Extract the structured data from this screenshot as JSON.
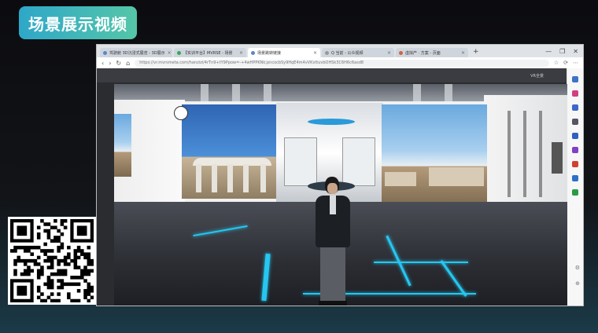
{
  "overlay": {
    "title": "场景展示视频"
  },
  "browser": {
    "tabs": [
      {
        "label": "驾驶舱 3D沉浸式展览 - 3D展示",
        "active": false
      },
      {
        "label": "【实训平台】MVRSE - 场景",
        "active": false
      },
      {
        "label": "场景跳转链接",
        "active": true
      },
      {
        "label": "Q 当前 - 公众视频",
        "active": false
      },
      {
        "label": "虚拟产 · 方案 - 页面",
        "active": false
      }
    ],
    "tab_close": "×",
    "new_tab": "+",
    "window_controls": [
      "—",
      "❐",
      "✕"
    ],
    "nav": {
      "back": "‹",
      "forward": "›",
      "reload": "↻",
      "home": "⌂"
    },
    "url": "https://vr.mvrsmeta.com/hanzizi/4rTn9+tY9Ppow=-+4wHPPKNk;pncocbSy9HqE4m4vVKvttuvbOHSk3C6H6c6asd8",
    "toolbar_icons": [
      "☆",
      "⟳",
      "⋯"
    ],
    "top_label": "VR全景",
    "side_icons": [
      {
        "name": "search",
        "color": "#3b73c8"
      },
      {
        "name": "star",
        "color": "#d04080"
      },
      {
        "name": "tag",
        "color": "#3c68c8"
      },
      {
        "name": "bag",
        "color": "#556"
      },
      {
        "name": "person",
        "color": "#3060c0"
      },
      {
        "name": "game",
        "color": "#8040c0"
      },
      {
        "name": "office",
        "color": "#d04030"
      },
      {
        "name": "outlook",
        "color": "#2d70c8"
      },
      {
        "name": "tree",
        "color": "#2a9a48"
      }
    ],
    "bottom_tools": [
      "⚙",
      "⊕"
    ]
  },
  "colors": {
    "accent": "#2ea7c9",
    "floor_glow": "#26c6f0"
  }
}
